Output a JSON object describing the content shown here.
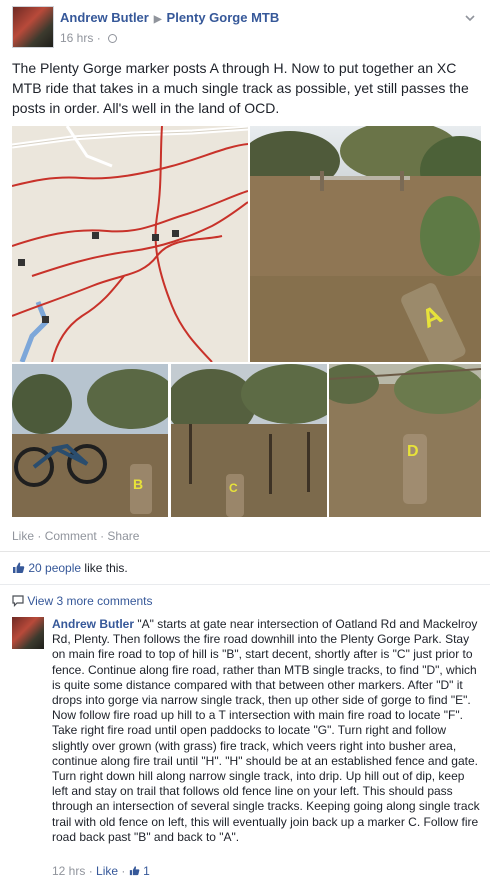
{
  "post": {
    "author": "Andrew Butler",
    "group": "Plenty Gorge MTB",
    "time": "16 hrs",
    "dot": "·",
    "text": "The Plenty Gorge marker posts A through H. Now to put together an XC MTB ride that takes in a much single track as possible, yet still passes the posts in order. All's well in the land of OCD.",
    "photo_labels": {
      "p2": "A",
      "p3": "B",
      "p4": "C",
      "p5": "D"
    }
  },
  "actions": {
    "like": "Like",
    "sep1": "·",
    "comment": "Comment",
    "sep2": "·",
    "share": "Share"
  },
  "likes": {
    "count": "20 people",
    "suffix": "like this."
  },
  "comments": {
    "view_more": "View 3 more comments",
    "items": [
      {
        "author": "Andrew Butler",
        "text": "\"A\" starts at gate near intersection of Oatland Rd and Mackelroy Rd, Plenty. Then follows the fire road downhill into the Plenty Gorge Park. Stay on main fire road to top of hill is \"B\", start decent, shortly after is \"C\" just prior to fence. Continue along fire road, rather than MTB single tracks, to find \"D\", which is quite some distance compared with that between other markers. After \"D\" it drops into gorge via narrow single track, then up other side of gorge to find \"E\". Now follow fire road up hill to a T intersection with main fire road to locate \"F\". Take right fire road until open paddocks to locate \"G\". Turn right and follow slightly over grown (with grass) fire track, which veers right into busher area, continue along fire trail until \"H\". \"H\" should be at an established fence and gate. Turn right down hill along narrow single track, into drip. Up hill out of dip, keep left and stay on trail that follows old fence line on your left. This should pass through an intersection of several single tracks. Keeping going along single track trail with old fence on left, this will eventually join back up a marker C. Follow fire road back past \"B\" and back to \"A\".",
        "time": "12 hrs",
        "like": "Like",
        "like_count": "1"
      }
    ]
  },
  "colors": {
    "link": "#365899",
    "meta": "#90949c",
    "text": "#1d2129",
    "map_trail": "#c8322a"
  }
}
